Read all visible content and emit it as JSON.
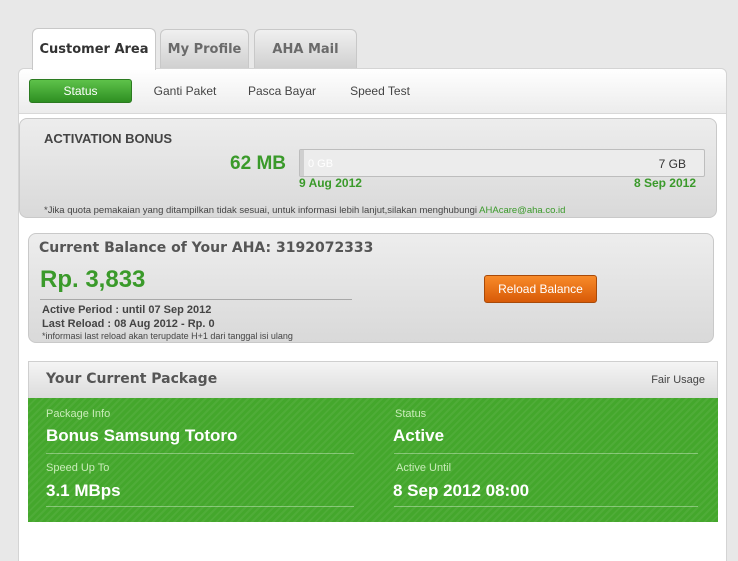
{
  "top_tabs": [
    "Customer Area",
    "My Profile",
    "AHA Mail"
  ],
  "subnav": [
    "Status",
    "Ganti Paket",
    "Pasca Bayar",
    "Speed Test"
  ],
  "activation": {
    "title": "ACTIVATION BONUS",
    "quota": "62 MB",
    "bar_min": "0 GB",
    "bar_max": "7 GB",
    "usage_fraction": 0.009,
    "date_start": "9 Aug 2012",
    "date_end": "8 Sep 2012",
    "note": "*Jika quota pemakaian yang ditampilkan tidak sesuai, untuk informasi lebih lanjut,silakan menghubungi",
    "email": "AHAcare@aha.co.id"
  },
  "balance": {
    "title": "Current Balance of Your AHA: 3192072333",
    "amount": "Rp. 3,833",
    "active_period": "Active Period : until 07 Sep 2012",
    "last_reload": "Last Reload : 08 Aug 2012 - Rp. 0",
    "note": "*informasi last reload akan terupdate H+1 dari tanggal isi ulang",
    "reload_label": "Reload Balance"
  },
  "package": {
    "title": "Your Current Package",
    "link": "Fair Usage",
    "info_label": "Package Info",
    "info_value": "Bonus Samsung Totoro",
    "status_label": "Status",
    "status_value": "Active",
    "speed_label": "Speed Up To",
    "speed_value": "3.1 MBps",
    "active_until_label": "Active Until",
    "active_until_value": "8 Sep 2012 08:00"
  },
  "colors": {
    "accent_green": "#3a9a2a",
    "package_green": "#44a72c",
    "button_orange": "#e8701a"
  }
}
